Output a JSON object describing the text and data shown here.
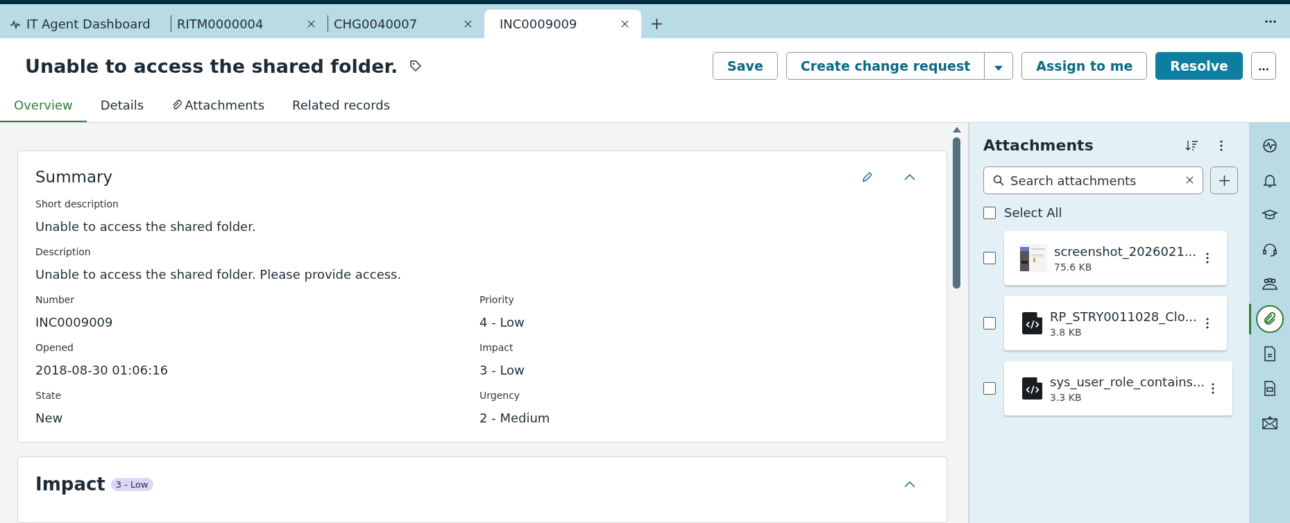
{
  "browser_tabs": [
    {
      "label": "IT Agent Dashboard",
      "kind": "dashboard",
      "selected": false
    },
    {
      "label": "RITM0000004",
      "kind": "record",
      "selected": false
    },
    {
      "label": "CHG0040007",
      "kind": "record",
      "selected": false
    },
    {
      "label": "INC0009009",
      "kind": "record",
      "selected": true
    }
  ],
  "record": {
    "title": "Unable to access the shared folder.",
    "actions": [
      {
        "label": "Save",
        "kind": "secondary"
      },
      {
        "label": "Create change request",
        "kind": "split"
      },
      {
        "label": "Assign to me",
        "kind": "secondary"
      },
      {
        "label": "Resolve",
        "kind": "primary"
      }
    ],
    "tabs": [
      {
        "label": "Overview",
        "selected": true,
        "kind": "plain"
      },
      {
        "label": "Details",
        "selected": false,
        "kind": "plain"
      },
      {
        "label": "Attachments",
        "selected": false,
        "kind": "attachments"
      },
      {
        "label": "Related records",
        "selected": false,
        "kind": "plain"
      }
    ]
  },
  "summary": {
    "title": "Summary",
    "wide_fields": [
      {
        "label": "Short description",
        "value": "Unable to access the shared folder."
      },
      {
        "label": "Description",
        "value": "Unable to access the shared folder. Please provide access."
      }
    ],
    "fields": [
      {
        "label": "Number",
        "value": "INC0009009"
      },
      {
        "label": "Priority",
        "value": "4 - Low"
      },
      {
        "label": "Opened",
        "value": "2018-08-30 01:06:16"
      },
      {
        "label": "Impact",
        "value": "3 - Low"
      },
      {
        "label": "State",
        "value": "New"
      },
      {
        "label": "Urgency",
        "value": "2 - Medium"
      }
    ]
  },
  "impact": {
    "title": "Impact",
    "badge": "3 - Low"
  },
  "attachments": {
    "title": "Attachments",
    "search": {
      "placeholder": "Search attachments"
    },
    "select_all": {
      "label": "Select All",
      "checked": false
    },
    "files": [
      {
        "name": "screenshot_2026021...",
        "size": "75.6 KB",
        "kind": "image",
        "checked": false
      },
      {
        "name": "RP_STRY0011028_Clo...",
        "size": "3.8 KB",
        "kind": "code",
        "checked": false
      },
      {
        "name": "sys_user_role_contains...",
        "size": "3.3 KB",
        "kind": "code",
        "checked": false
      }
    ]
  },
  "rail": [
    {
      "selected": false
    },
    {
      "selected": false
    },
    {
      "selected": false
    },
    {
      "selected": false
    },
    {
      "selected": false
    },
    {
      "selected": true
    },
    {
      "selected": false
    },
    {
      "selected": false
    },
    {
      "selected": false
    }
  ]
}
